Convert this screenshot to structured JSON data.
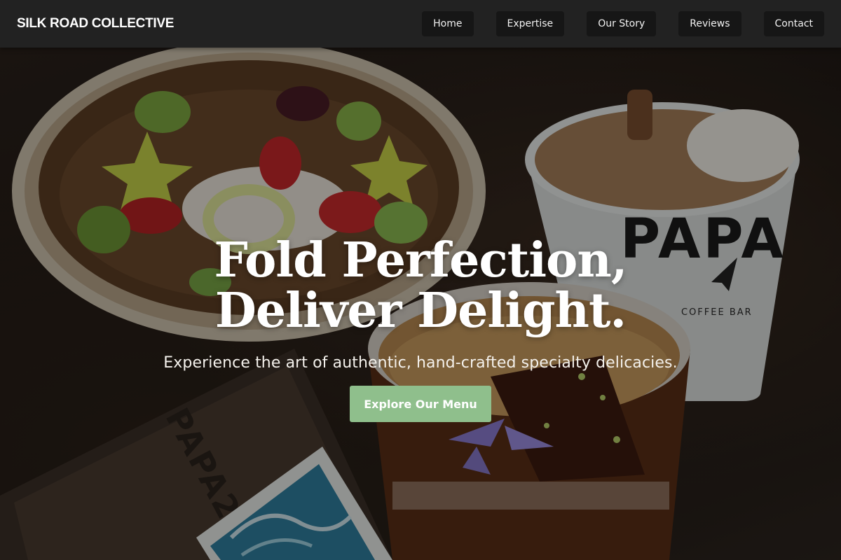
{
  "header": {
    "brand": "SILK ROAD COLLECTIVE",
    "nav": [
      {
        "label": "Home"
      },
      {
        "label": "Expertise"
      },
      {
        "label": "Our Story"
      },
      {
        "label": "Reviews"
      },
      {
        "label": "Contact"
      }
    ]
  },
  "hero": {
    "headline_line1": "Fold Perfection,",
    "headline_line2": "Deliver Delight.",
    "subtitle": "Experience the art of authentic, hand-crafted specialty delicacies.",
    "cta_label": "Explore Our Menu",
    "cup_text": "PAPA",
    "cup_subtext": "COFFEE BAR",
    "tray_text": "PAPA22"
  },
  "colors": {
    "header_bg": "#222222",
    "nav_button_bg": "#161616",
    "cta_bg": "#8fbf8c",
    "text": "#ffffff"
  },
  "icons": {
    "cup_logo": "paper-plane-icon"
  }
}
